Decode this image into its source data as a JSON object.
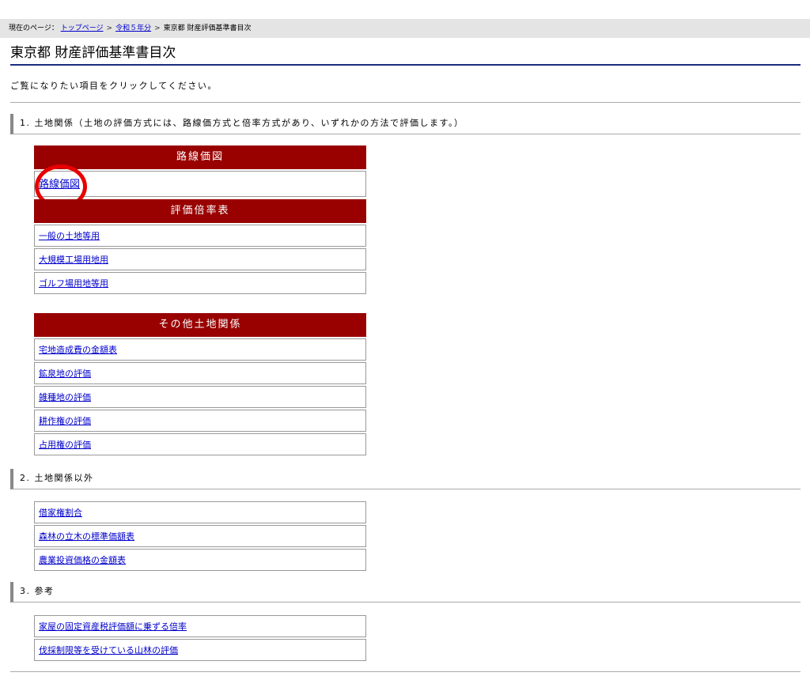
{
  "breadcrumb": {
    "label": "現在のページ：",
    "items": [
      "トップページ",
      "令和５年分"
    ],
    "current": "東京都 財産評価基準書目次"
  },
  "title": "東京都 財産評価基準書目次",
  "intro": "ご覧になりたい項目をクリックしてください。",
  "sections": [
    {
      "heading": "1. 土地関係（土地の評価方式には、路線価方式と倍率方式があり、いずれかの方法で評価します。）"
    },
    {
      "heading": "2. 土地関係以外"
    },
    {
      "heading": "3. 参考"
    }
  ],
  "rosenka": {
    "header": "路線価図",
    "link": "路線価図"
  },
  "bairitsu": {
    "header": "評価倍率表",
    "links": [
      "一般の土地等用",
      "大規模工場用地用",
      "ゴルフ場用地等用"
    ]
  },
  "other_land": {
    "header": "その他土地関係",
    "links": [
      "宅地造成費の金額表",
      "鉱泉地の評価",
      "雑種地の評価",
      "耕作権の評価",
      "占用権の評価"
    ]
  },
  "non_land": {
    "links": [
      "借家権割合",
      "森林の立木の標準価額表",
      "農業投資価格の金額表"
    ]
  },
  "reference": {
    "links": [
      "家屋の固定資産税評価額に乗ずる倍率",
      "伐採制限等を受けている山林の評価"
    ]
  },
  "colors": {
    "header_red": "#990000",
    "title_rule": "#1a2b80",
    "annotation_circle": "#e80000"
  }
}
